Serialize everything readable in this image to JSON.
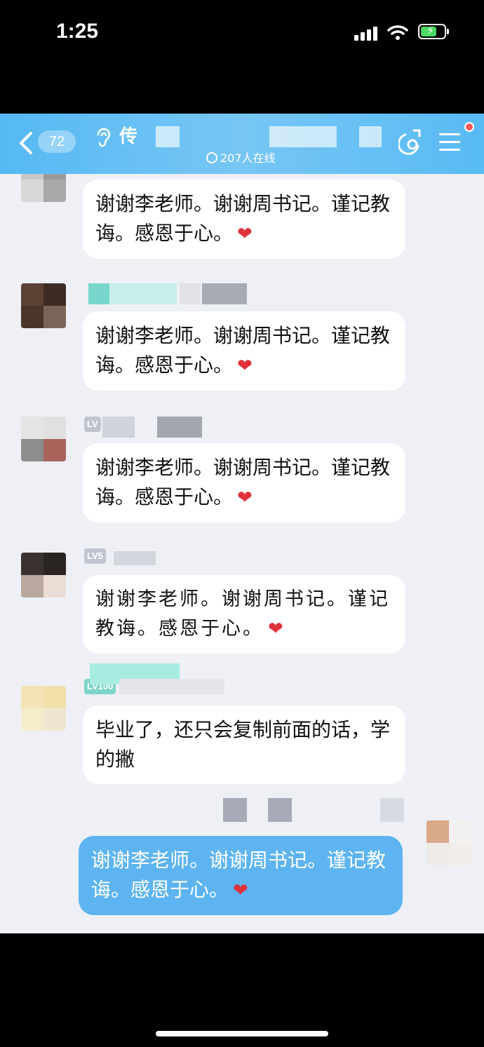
{
  "status_bar": {
    "time": "1:25"
  },
  "header": {
    "unread_count": "72",
    "group_title_visible": "传",
    "online_text": "207人在线",
    "accent_color": "#58bbf3"
  },
  "messages": [
    {
      "sender_level": "",
      "text": "谢谢李老师。谢谢周书记。谨记教诲。感恩于心。",
      "heart": "❤"
    },
    {
      "sender_level": "",
      "text": "谢谢李老师。谢谢周书记。谨记教诲。感恩于心。",
      "heart": "❤"
    },
    {
      "sender_level": "LV",
      "text": "谢谢李老师。谢谢周书记。谨记教诲。感恩于心。",
      "heart": "❤"
    },
    {
      "sender_level": "LV5",
      "text": "谢谢李老师。谢谢周书记。谨记教诲。感恩于心。",
      "heart": "❤"
    },
    {
      "sender_level": "LV100",
      "text": "毕业了，还只会复制前面的话，学的撇",
      "heart": ""
    },
    {
      "sender_level": "",
      "text": "谢谢李老师。谢谢周书记。谨记教诲。感恩于心。",
      "heart": "❤",
      "self": true
    }
  ]
}
